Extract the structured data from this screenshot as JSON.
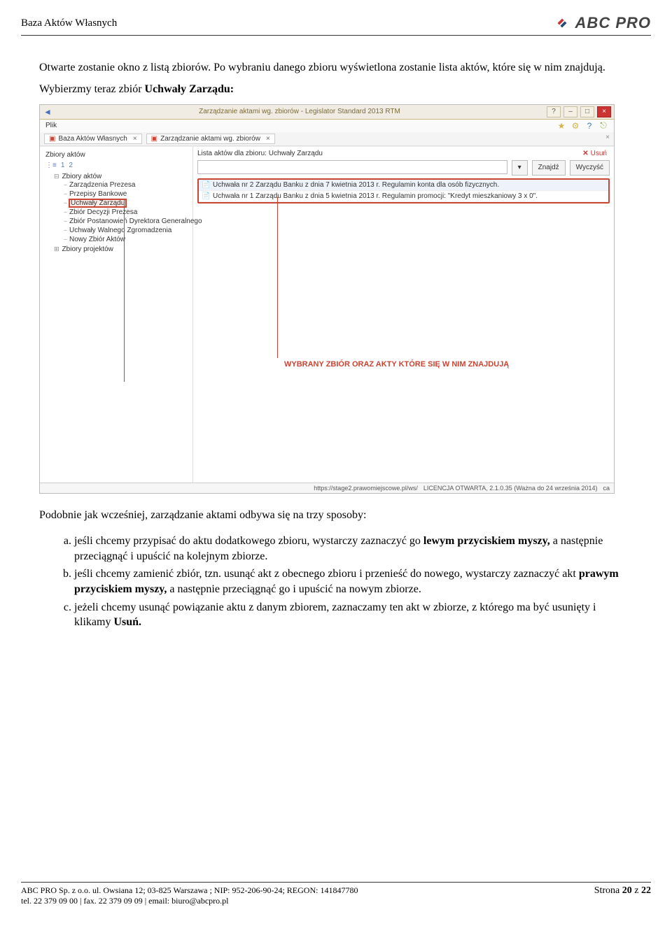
{
  "header": {
    "title": "Baza Aktów Własnych"
  },
  "logo": {
    "brand": "ABC PRO"
  },
  "intro": {
    "p1a": "Otwarte zostanie okno z listą zbiorów. Po wybraniu danego zbioru wyświetlona zostanie lista aktów, które się w nim znajdują.",
    "p1b_prefix": "Wybierzmy teraz zbiór ",
    "p1b_bold": "Uchwały Zarządu:"
  },
  "app": {
    "title": "Zarządzanie aktami wg. zbiorów - Legislator Standard 2013 RTM",
    "menu": {
      "file": "Plik"
    },
    "tabs": [
      {
        "label": "Baza Aktów Własnych"
      },
      {
        "label": "Zarządzanie aktami wg. zbiorów"
      }
    ],
    "sidebar": {
      "panel_title": "Zbiory aktów",
      "tool1": "1",
      "tool2": "2",
      "tree": {
        "root": "Zbiory aktów",
        "items": [
          "Zarządzenia Prezesa",
          "Przepisy Bankowe",
          "Uchwały Zarządu",
          "Zbiór Decyzji Prezesa",
          "Zbiór Postanowień Dyrektora Generalnego",
          "Uchwały Walnego Zgromadzenia",
          "Nowy Zbiór Aktów"
        ],
        "last": "Zbiory projektów"
      }
    },
    "main": {
      "panel_title": "Lista aktów dla zbioru: Uchwały Zarządu",
      "delete_label": "Usuń",
      "btn_find": "Znajdź",
      "btn_clear": "Wyczyść",
      "search_placeholder": "",
      "rows": [
        "Uchwała nr 2 Zarządu Banku z dnia 7 kwietnia 2013 r. Regulamin konta dla osób fizycznych.",
        "Uchwała nr 1 Zarządu Banku z dnia 5 kwietnia 2013 r. Regulamin promocji: \"Kredyt mieszkaniowy 3 x 0\"."
      ]
    },
    "callout": "WYBRANY ZBIÓR ORAZ AKTY KTÓRE SIĘ W NIM ZNAJDUJĄ",
    "status": {
      "url": "https://stage2.prawomiejscowe.pl/ws/",
      "license": "LICENCJA OTWARTA, 2.1.0.35 (Ważna do 24 września 2014)",
      "ca": "ca"
    }
  },
  "after": {
    "p": "Podobnie jak wcześniej, zarządzanie aktami odbywa się na trzy sposoby:",
    "a_prefix": "jeśli chcemy przypisać do aktu dodatkowego zbioru, wystarczy zaznaczyć go ",
    "a_bold": "lewym przyciskiem myszy,",
    "a_suffix": " a następnie przeciągnąć i upuścić na kolejnym zbiorze.",
    "b_prefix": "jeśli chcemy zamienić zbiór, tzn. usunąć akt z obecnego zbioru i przenieść do nowego, wystarczy zaznaczyć akt ",
    "b_bold": "prawym przyciskiem myszy,",
    "b_suffix": " a następnie przeciągnąć go i upuścić na nowym zbiorze.",
    "c_prefix": "jeżeli chcemy usunąć powiązanie aktu z danym zbiorem, zaznaczamy ten akt w zbiorze, z którego ma być usunięty i klikamy ",
    "c_bold": "Usuń."
  },
  "footer": {
    "l1": "ABC PRO Sp. z o.o. ul. Owsiana 12; 03-825 Warszawa ; NIP: 952-206-90-24; REGON: 141847780",
    "l2": "tel. 22 379 09 00 | fax. 22 379 09 09 | email: biuro@abcpro.pl",
    "page_prefix": "Strona ",
    "page_no": "20",
    "page_mid": " z ",
    "page_total": "22"
  }
}
